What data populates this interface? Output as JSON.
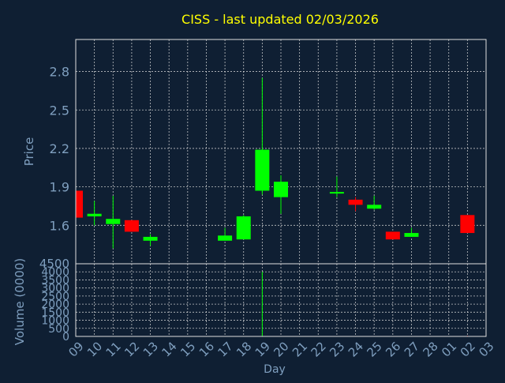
{
  "colors": {
    "background": "#0f1f33",
    "title": "#ffff00",
    "axis_text": "#7f9fbf",
    "plot_frame": "#dfdfdf",
    "grid": "#dfdfdf",
    "up": "#00ff00",
    "down": "#ff0000"
  },
  "chart_data": {
    "type": "candlestick",
    "title": "CISS - last updated 02/03/2026",
    "xlabel": "Day",
    "grid": true,
    "x_tick_labels": [
      "09",
      "10",
      "11",
      "12",
      "13",
      "14",
      "15",
      "16",
      "17",
      "18",
      "19",
      "20",
      "21",
      "22",
      "23",
      "24",
      "25",
      "26",
      "27",
      "28",
      "01",
      "02",
      "03"
    ],
    "price_panel": {
      "ylabel": "Price",
      "ylim": [
        1.3,
        3.05
      ],
      "yticks": [
        1.6,
        1.9,
        2.2,
        2.5,
        2.8
      ],
      "ytick_labels": [
        "1.6",
        "1.9",
        "2.2",
        "2.5",
        "2.8"
      ]
    },
    "volume_panel": {
      "ylabel": "Volume (0000)",
      "ylim": [
        0,
        4500
      ],
      "yticks": [
        0,
        500,
        1000,
        1500,
        2000,
        2500,
        3000,
        3500,
        4000,
        4500
      ],
      "ytick_labels": [
        "0",
        "500",
        "1000",
        "1500",
        "2000",
        "2500",
        "3000",
        "3500",
        "4000",
        "4500"
      ]
    },
    "candles": [
      {
        "day": "09",
        "open": 1.87,
        "high": 1.87,
        "low": 1.66,
        "close": 1.66,
        "volume": 0
      },
      {
        "day": "10",
        "open": 1.67,
        "high": 1.79,
        "low": 1.6,
        "close": 1.69,
        "volume": 0
      },
      {
        "day": "11",
        "open": 1.61,
        "high": 1.83,
        "low": 1.42,
        "close": 1.65,
        "volume": 0
      },
      {
        "day": "12",
        "open": 1.64,
        "high": 1.64,
        "low": 1.55,
        "close": 1.55,
        "volume": 0
      },
      {
        "day": "13",
        "open": 1.48,
        "high": 1.53,
        "low": 1.44,
        "close": 1.51,
        "volume": 0
      },
      {
        "day": "17",
        "open": 1.48,
        "high": 1.58,
        "low": 1.48,
        "close": 1.52,
        "volume": 0
      },
      {
        "day": "18",
        "open": 1.49,
        "high": 1.68,
        "low": 1.49,
        "close": 1.67,
        "volume": 0
      },
      {
        "day": "19",
        "open": 1.87,
        "high": 2.75,
        "low": 1.84,
        "close": 2.19,
        "volume": 4000
      },
      {
        "day": "20",
        "open": 1.82,
        "high": 1.99,
        "low": 1.69,
        "close": 1.94,
        "volume": 0
      },
      {
        "day": "23",
        "open": 1.85,
        "high": 1.98,
        "low": 1.82,
        "close": 1.86,
        "volume": 0
      },
      {
        "day": "24",
        "open": 1.8,
        "high": 1.82,
        "low": 1.71,
        "close": 1.76,
        "volume": 0
      },
      {
        "day": "25",
        "open": 1.73,
        "high": 1.83,
        "low": 1.72,
        "close": 1.76,
        "volume": 0
      },
      {
        "day": "26",
        "open": 1.55,
        "high": 1.55,
        "low": 1.49,
        "close": 1.49,
        "volume": 0
      },
      {
        "day": "27",
        "open": 1.51,
        "high": 1.58,
        "low": 1.51,
        "close": 1.54,
        "volume": 0
      },
      {
        "day": "02",
        "open": 1.68,
        "high": 1.68,
        "low": 1.54,
        "close": 1.54,
        "volume": 40
      }
    ]
  }
}
